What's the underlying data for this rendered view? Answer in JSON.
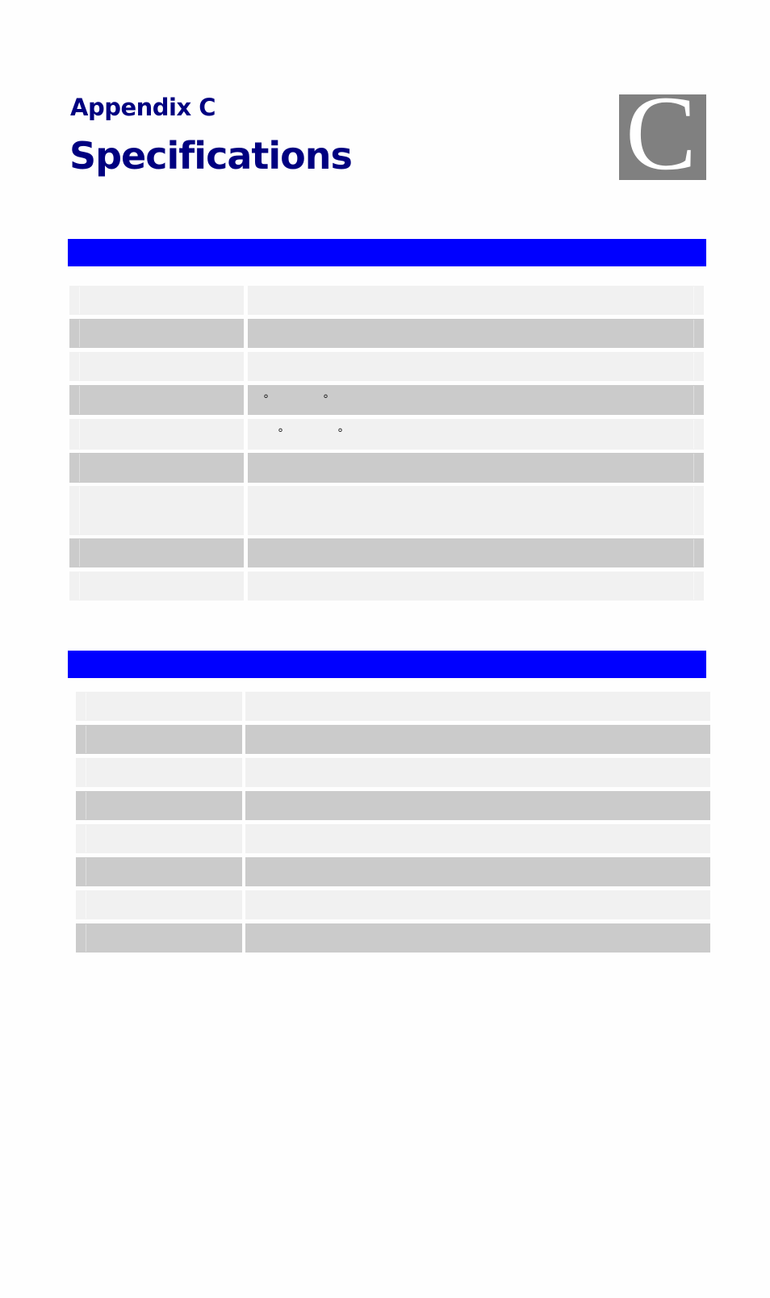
{
  "header": {
    "appendix_label": "Appendix C",
    "title": "Specifications",
    "chapter_letter": "C"
  },
  "colors": {
    "title": "#000080",
    "section_bar": "#0000ff",
    "row_light": "#f1f1f1",
    "row_dark": "#cbcbcb",
    "badge": "#808080"
  },
  "sections": [
    {
      "heading": "",
      "rows": [
        {
          "label": "",
          "value": ""
        },
        {
          "label": "",
          "value": ""
        },
        {
          "label": "",
          "value": ""
        },
        {
          "label": "",
          "value": "",
          "symbols": [
            "°",
            "°"
          ]
        },
        {
          "label": "",
          "value": "",
          "symbols": [
            "°",
            "°"
          ]
        },
        {
          "label": "",
          "value": ""
        },
        {
          "label": "",
          "value": ""
        },
        {
          "label": "",
          "value": ""
        },
        {
          "label": "",
          "value": ""
        }
      ]
    },
    {
      "heading": "",
      "rows": [
        {
          "label": "",
          "value": ""
        },
        {
          "label": "",
          "value": ""
        },
        {
          "label": "",
          "value": ""
        },
        {
          "label": "",
          "value": ""
        },
        {
          "label": "",
          "value": ""
        },
        {
          "label": "",
          "value": ""
        },
        {
          "label": "",
          "value": ""
        },
        {
          "label": "",
          "value": ""
        }
      ]
    }
  ]
}
